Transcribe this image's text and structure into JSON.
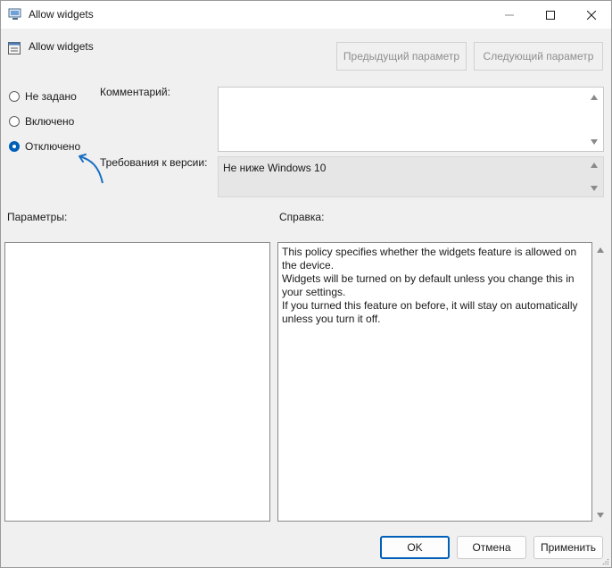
{
  "window": {
    "title": "Allow widgets"
  },
  "policy": {
    "title": "Allow widgets",
    "prev_button": "Предыдущий параметр",
    "next_button": "Следующий параметр"
  },
  "options": [
    {
      "label": "Не задано",
      "checked": false
    },
    {
      "label": "Включено",
      "checked": false
    },
    {
      "label": "Отключено",
      "checked": true
    }
  ],
  "fields": {
    "comment_label": "Комментарий:",
    "comment_value": "",
    "requirements_label": "Требования к версии:",
    "requirements_value": "Не ниже Windows 10"
  },
  "panels": {
    "params_label": "Параметры:",
    "help_label": "Справка:",
    "help_lines": [
      "This policy specifies whether the widgets feature is allowed on the device.",
      "Widgets will be turned on by default unless you change this in your settings.",
      "If you turned this feature on before, it will stay on automatically unless you turn it off."
    ]
  },
  "buttons": {
    "ok": "OK",
    "cancel": "Отмена",
    "apply": "Применить"
  },
  "colors": {
    "accent": "#005fb8",
    "annotation_arrow": "#1a6fc4"
  },
  "icons": [
    "policy-app-icon",
    "minimize-icon",
    "maximize-icon",
    "close-icon",
    "policy-setting-icon"
  ]
}
